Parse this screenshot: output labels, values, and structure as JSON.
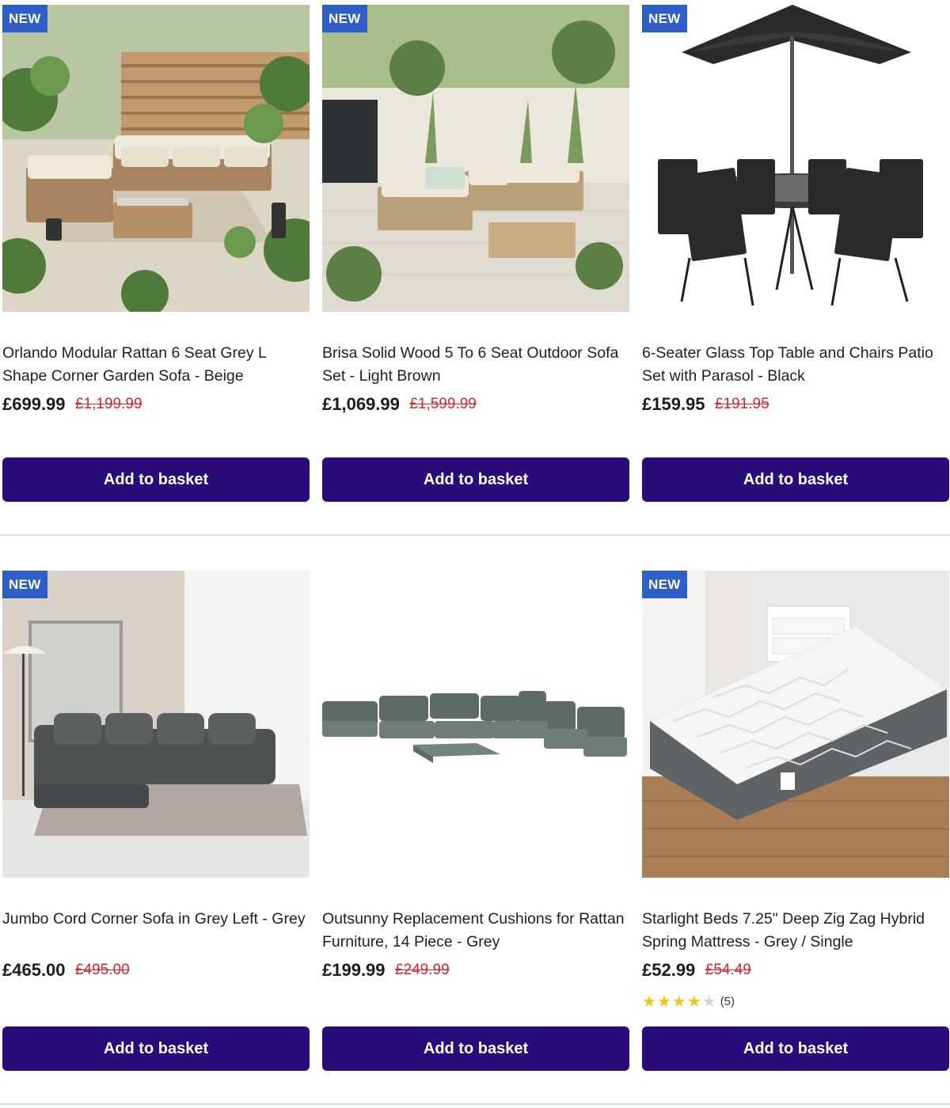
{
  "products": [
    {
      "badge": "NEW",
      "image": "rattan-l-shape-sofa-photo",
      "title": "Orlando Modular Rattan 6 Seat Grey L Shape Corner Garden Sofa - Beige",
      "price": "£699.99",
      "was_price": "£1,199.99",
      "button": "Add to basket"
    },
    {
      "badge": "NEW",
      "image": "wooden-outdoor-sofa-photo",
      "title": "Brisa Solid Wood 5 To 6 Seat Outdoor Sofa Set - Light Brown",
      "price": "£1,069.99",
      "was_price": "£1,599.99",
      "button": "Add to basket"
    },
    {
      "badge": "NEW",
      "image": "patio-dining-set-parasol-photo",
      "title": "6-Seater Glass Top Table and Chairs Patio Set with Parasol - Black",
      "price": "£159.95",
      "was_price": "£191.95",
      "button": "Add to basket"
    },
    {
      "badge": "NEW",
      "image": "grey-corner-sofa-photo",
      "title": "Jumbo Cord Corner Sofa in Grey Left - Grey",
      "price": "£465.00",
      "was_price": "£495.00",
      "button": "Add to basket"
    },
    {
      "badge": "",
      "image": "grey-replacement-cushions-photo",
      "title": "Outsunny Replacement Cushions for Rattan Furniture, 14 Piece - Grey",
      "price": "£199.99",
      "was_price": "£249.99",
      "button": "Add to basket"
    },
    {
      "badge": "NEW",
      "image": "hybrid-mattress-photo",
      "title": "Starlight Beds 7.25\" Deep Zig Zag Hybrid Spring Mattress - Grey / Single",
      "price": "£52.99",
      "was_price": "£54.49",
      "rating": 4,
      "rating_max": 5,
      "review_count": "(5)",
      "button": "Add to basket"
    }
  ],
  "colors": {
    "badge": "#2e5fc8",
    "button": "#2a0b7a",
    "was_price": "#d0272d",
    "star": "#f5c21b"
  }
}
